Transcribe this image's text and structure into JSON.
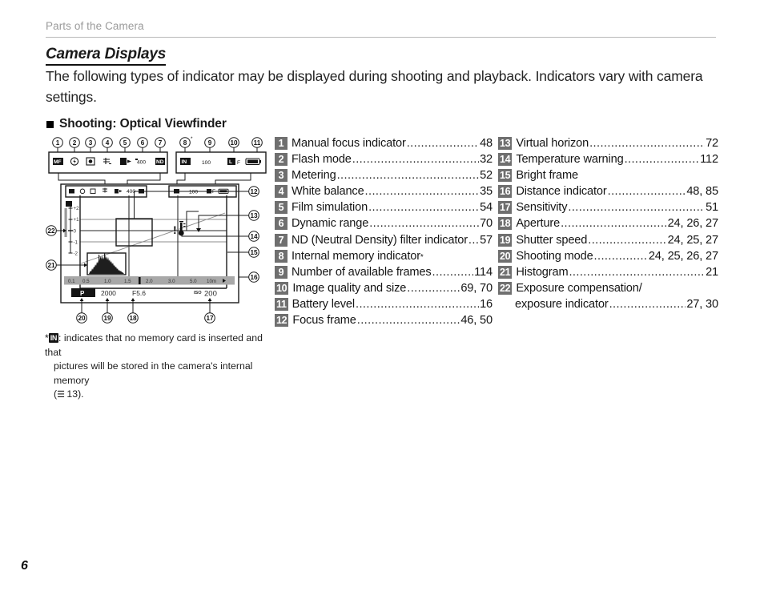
{
  "header": {
    "running_head": "Parts of the Camera"
  },
  "section": {
    "title": "Camera Displays",
    "intro": "The following types of indicator may be displayed during shooting and playback. Indicators vary with camera settings.",
    "subsection_heading": "Shooting: Optical Viewfinder"
  },
  "figure": {
    "top_callouts_left": [
      "1",
      "2",
      "3",
      "4",
      "5",
      "6",
      "7"
    ],
    "top_callouts_right": [
      "8",
      "9",
      "10",
      "11"
    ],
    "top_bar_left_icons": [
      "MF",
      "flash-icon",
      "metering-icon",
      "white-balance-icon",
      "film-simulation-icon",
      "dynamic-range-icon",
      "nd-icon"
    ],
    "top_bar_left_values": [
      "MF",
      "ⓘ",
      "▣",
      "WB",
      "FS",
      "400",
      "ND"
    ],
    "top_bar_right_values": [
      "IN",
      "100",
      "L",
      "F",
      "battery-icon"
    ],
    "frame_count": "100",
    "image_size": "L",
    "image_quality": "F",
    "internal_memory": "IN",
    "exposure_scale": [
      "+2",
      "+1",
      "0",
      "-1",
      "-2"
    ],
    "distance_scale": [
      "0.1",
      "0.5",
      "1.0",
      "1.5",
      "2.0",
      "3.0",
      "5.0",
      "10m"
    ],
    "shooting_mode": "P",
    "shutter_speed": "2000",
    "aperture": "F5.6",
    "iso_prefix": "ISO",
    "iso_value": "200",
    "right_callouts": [
      "12",
      "13",
      "14",
      "15",
      "16"
    ],
    "bottom_callouts": [
      "20",
      "19",
      "18",
      "17"
    ],
    "left_callouts": [
      "22",
      "21"
    ]
  },
  "footnote": {
    "star": "*",
    "icon": "IN",
    "line1": ": indicates that no memory card is inserted and that",
    "line2": "pictures will be stored in the camera's internal memory",
    "line3_open": "(",
    "line3_book": "☰",
    "line3_rest": " 13)."
  },
  "index": {
    "column_1": [
      {
        "num": "1",
        "label": "Manual focus indicator",
        "page": "48"
      },
      {
        "num": "2",
        "label": "Flash mode",
        "page": "32"
      },
      {
        "num": "3",
        "label": "Metering",
        "page": "52"
      },
      {
        "num": "4",
        "label": "White balance",
        "page": "35"
      },
      {
        "num": "5",
        "label": "Film simulation",
        "page": "54"
      },
      {
        "num": "6",
        "label": "Dynamic range",
        "page": "70"
      },
      {
        "num": "7",
        "label": "ND (Neutral Density) filter indicator",
        "page": "57"
      },
      {
        "num": "8",
        "label": "Internal memory indicator",
        "page": "",
        "star": true
      },
      {
        "num": "9",
        "label": "Number of available frames",
        "page": "114"
      },
      {
        "num": "10",
        "label": "Image quality and size",
        "page": "69, 70"
      },
      {
        "num": "11",
        "label": "Battery level",
        "page": "16"
      },
      {
        "num": "12",
        "label": "Focus frame",
        "page": "46, 50"
      }
    ],
    "column_2": [
      {
        "num": "13",
        "label": "Virtual horizon",
        "page": "72"
      },
      {
        "num": "14",
        "label": "Temperature warning",
        "page": "112"
      },
      {
        "num": "15",
        "label": "Bright frame",
        "page": ""
      },
      {
        "num": "16",
        "label": "Distance indicator",
        "page": "48, 85"
      },
      {
        "num": "17",
        "label": "Sensitivity",
        "page": "51"
      },
      {
        "num": "18",
        "label": "Aperture",
        "page": "24, 26, 27"
      },
      {
        "num": "19",
        "label": "Shutter speed",
        "page": "24, 25, 27"
      },
      {
        "num": "20",
        "label": "Shooting mode",
        "page": "24, 25, 26, 27"
      },
      {
        "num": "21",
        "label": "Histogram",
        "page": "21"
      },
      {
        "num": "22",
        "label": "Exposure compensation/",
        "page": "",
        "continuation": {
          "label": "exposure indicator",
          "page": "27, 30"
        }
      }
    ]
  },
  "page_number": "6",
  "colors": {
    "badge_bg": "#6f6f6f",
    "badge_text": "#ffffff",
    "running_head": "#9b9b9b",
    "rule": "#b9b9b9",
    "text": "#1a1a1a",
    "scale_bar": "#9a9a9a"
  }
}
